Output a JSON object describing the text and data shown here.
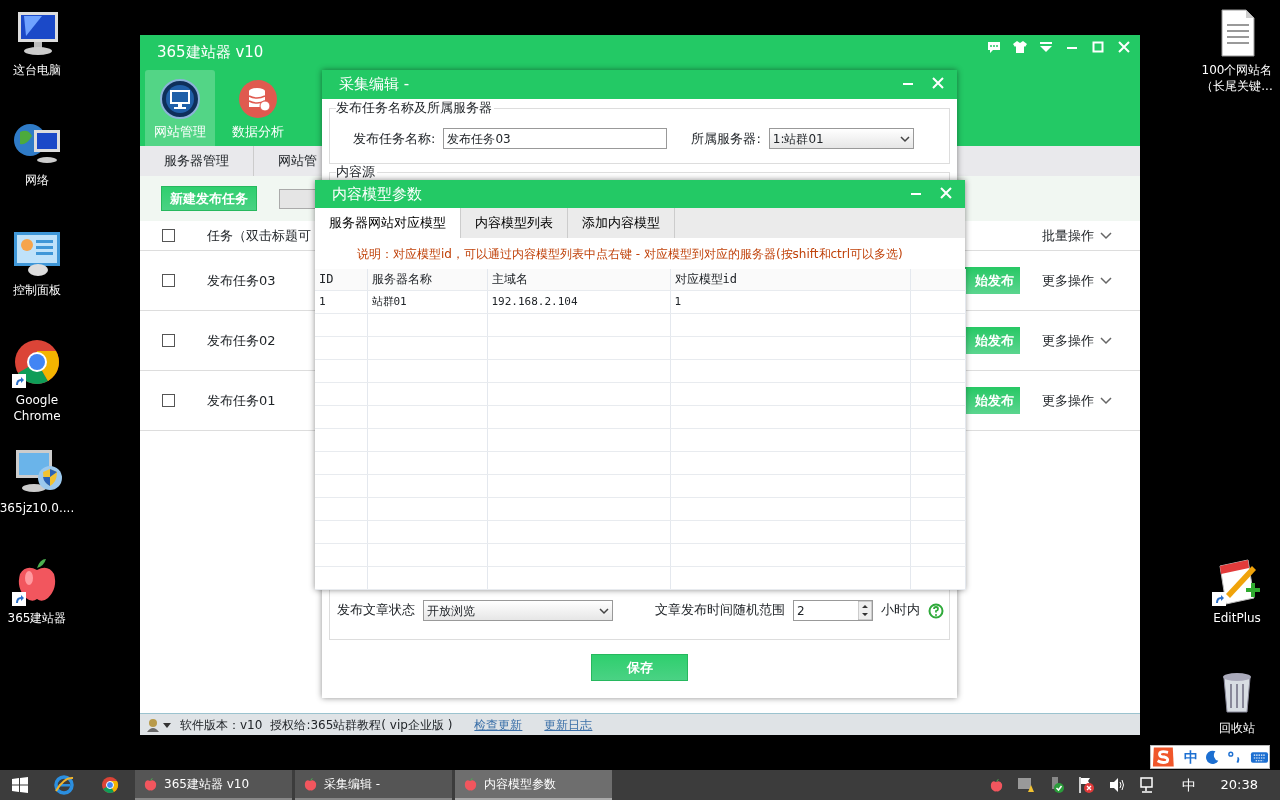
{
  "desktop_left": [
    {
      "label": "这台电脑",
      "kind": "computer",
      "shortcut": false
    },
    {
      "label": "网络",
      "kind": "network",
      "shortcut": false
    },
    {
      "label": "控制面板",
      "kind": "panel",
      "shortcut": false
    },
    {
      "label": "Google Chrome",
      "kind": "chrome",
      "shortcut": true
    },
    {
      "label": "365jz10.0....",
      "kind": "installer",
      "shortcut": false
    },
    {
      "label": "365建站器",
      "kind": "apple",
      "shortcut": true
    }
  ],
  "desktop_right": [
    {
      "lines": [
        "100个网站名",
        "（长尾关键..."
      ],
      "kind": "document",
      "shortcut": false
    },
    {
      "lines": [
        "EditPlus"
      ],
      "kind": "editplus",
      "shortcut": true
    },
    {
      "lines": [
        "回收站"
      ],
      "kind": "bin",
      "shortcut": false
    }
  ],
  "main_window": {
    "title": "365建站器 v10",
    "toolbar": [
      {
        "label": "网站管理",
        "kind": "monitor",
        "selected": true
      },
      {
        "label": "数据分析",
        "kind": "database",
        "selected": false
      }
    ],
    "subnav": [
      "服务器管理",
      "网站管"
    ],
    "new_task_button": "新建发布任务",
    "task_header": {
      "label": "任务（双击标题可",
      "checked": false,
      "batch": "批量操作"
    },
    "tasks": [
      {
        "name": "发布任务03",
        "publish": "始发布",
        "more": "更多操作",
        "checked": false
      },
      {
        "name": "发布任务02",
        "publish": "始发布",
        "more": "更多操作",
        "checked": false
      },
      {
        "name": "发布任务01",
        "publish": "始发布",
        "more": "更多操作",
        "checked": false
      }
    ],
    "status_bar": {
      "version": "软件版本：v10",
      "license": "授权给:365站群教程( vip企业版 )",
      "links": [
        "检查更新",
        "更新日志"
      ]
    }
  },
  "editor_dialog": {
    "title": "采集编辑 -",
    "group_title": "发布任务名称及所属服务器",
    "task_name_label": "发布任务名称:",
    "task_name": "发布任务03",
    "server_label": "所属服务器:",
    "server": "1:站群01",
    "source_title": "内容源",
    "status_label": "发布文章状态",
    "status": "开放浏览",
    "range_label": "文章发布时间随机范围",
    "range": "2",
    "range_unit": "小时内",
    "save": "保存"
  },
  "model_dialog": {
    "title": "内容模型参数",
    "tabs": [
      {
        "label": "服务器网站对应模型",
        "selected": true
      },
      {
        "label": "内容模型列表",
        "selected": false
      },
      {
        "label": "添加内容模型",
        "selected": false
      }
    ],
    "note": "说明：对应模型id，可以通过内容模型列表中点右键 - 对应模型到对应的服务器(按shift和ctrl可以多选)",
    "columns": [
      "ID",
      "服务器名称",
      "主域名",
      "对应模型id"
    ],
    "rows": [
      [
        "1",
        "站群01",
        "192.168.2.104",
        "1"
      ]
    ]
  },
  "ime_bar": {
    "mode": "中"
  },
  "taskbar": {
    "tasks": [
      {
        "label": "365建站器 v10",
        "selected": false
      },
      {
        "label": "采集编辑 -",
        "selected": false
      },
      {
        "label": "内容模型参数",
        "selected": true
      }
    ],
    "language": "中",
    "time": "20:38"
  }
}
